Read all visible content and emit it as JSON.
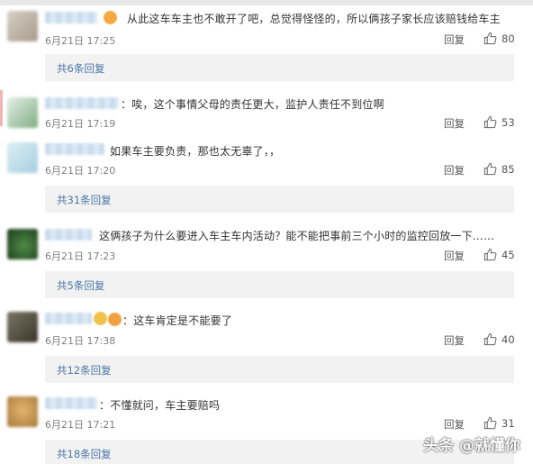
{
  "comments": [
    {
      "text": "从此这车车主也不敢开了吧，总觉得怪怪的，所以俩孩子家长应该赔钱给车主",
      "time": "6月21日 17:25",
      "reply_label": "回复",
      "likes": "80",
      "replies_link": "共6条回复",
      "avatar_color": "#b9ada0"
    },
    {
      "text": "：唉，这个事情父母的责任更大，监护人责任不到位啊",
      "time": "6月21日 17:19",
      "reply_label": "回复",
      "likes": "53",
      "replies_link": "",
      "avatar_color": "#6f9a72"
    },
    {
      "text": "如果车主要负责，那也太无辜了，，",
      "time": "6月21日 17:20",
      "reply_label": "回复",
      "likes": "85",
      "replies_link": "共31条回复",
      "avatar_color": "#bcdce8"
    },
    {
      "text": "这俩孩子为什么要进入车主车内活动？能不能把事前三个小时的监控回放一下……",
      "time": "6月21日 17:23",
      "reply_label": "回复",
      "likes": "45",
      "replies_link": "共5条回复",
      "avatar_color": "#2f5a2c"
    },
    {
      "text": "：这车肯定是不能要了",
      "time": "6月21日 17:38",
      "reply_label": "回复",
      "likes": "40",
      "replies_link": "共12条回复",
      "avatar_color": "#4f4a3e"
    },
    {
      "text": "：不懂就问，车主要赔吗",
      "time": "6月21日 17:21",
      "reply_label": "回复",
      "likes": "31",
      "replies_link": "共18条回复",
      "avatar_color": "#caa061"
    }
  ],
  "watermark": "头条 @就懂你",
  "icons": {
    "like": "thumbs-up-icon",
    "emoji": "emoji-icon"
  },
  "colors": {
    "link": "#4a76a8",
    "reply_bar": "#f2f2f2",
    "time": "#808080"
  }
}
